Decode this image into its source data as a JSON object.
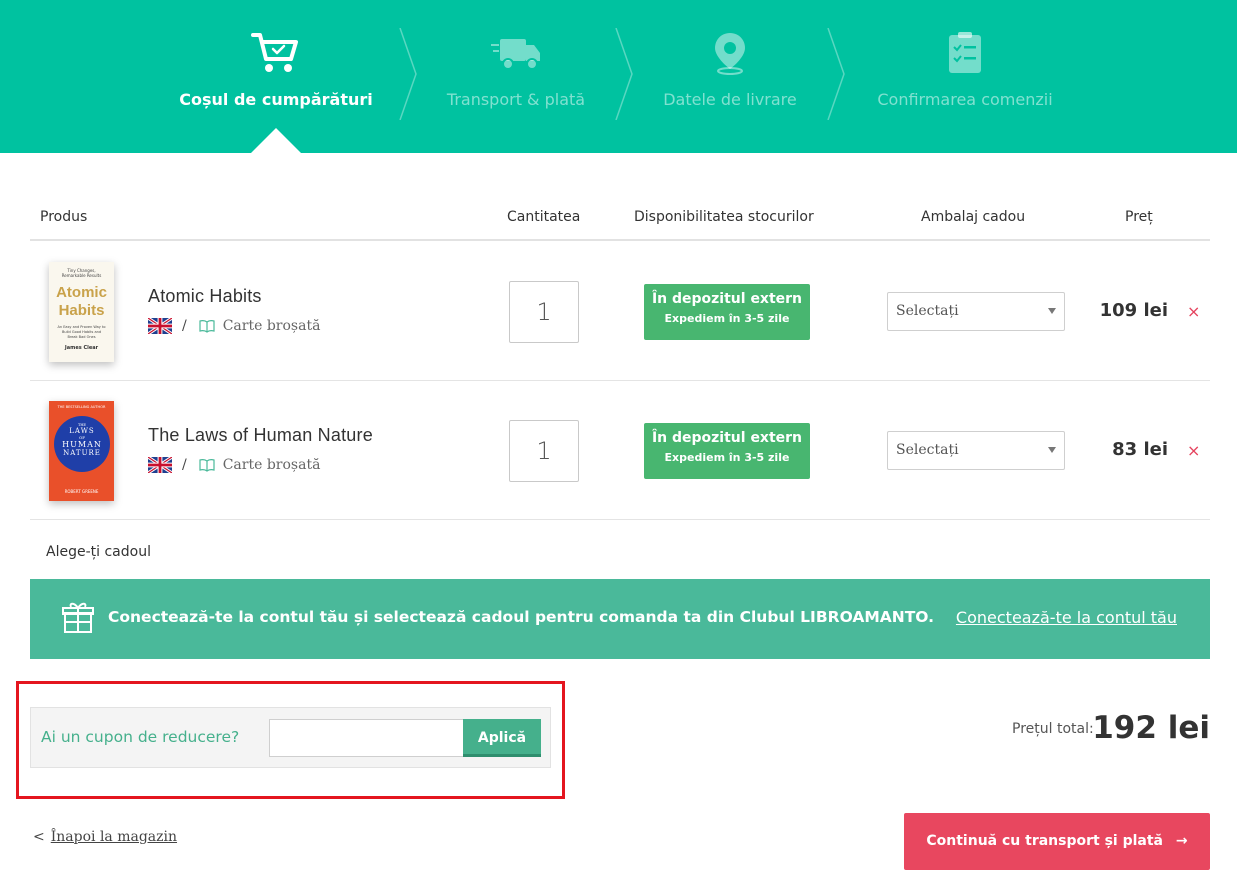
{
  "steps": [
    {
      "label": "Coșul de cumpărături",
      "icon": "cart-icon",
      "active": true
    },
    {
      "label": "Transport & plată",
      "icon": "truck-icon",
      "active": false
    },
    {
      "label": "Datele de livrare",
      "icon": "location-pin-icon",
      "active": false
    },
    {
      "label": "Confirmarea comenzii",
      "icon": "checklist-icon",
      "active": false
    }
  ],
  "table": {
    "headers": {
      "product": "Produs",
      "quantity": "Cantitatea",
      "stock": "Disponibilitatea stocurilor",
      "gift_wrap": "Ambalaj cadou",
      "price": "Preț"
    },
    "rows": [
      {
        "title": "Atomic Habits",
        "format": "Carte broșată",
        "separator": "/",
        "quantity": "1",
        "stock_main": "În depozitul extern",
        "stock_sub": "Expediem în 3-5 zile",
        "gift_select": "Selectați",
        "price": "109 lei",
        "remove": "×",
        "cover": {
          "top": "Tiny Changes, Remarkable Results",
          "title1": "Atomic",
          "title2": "Habits",
          "subtitle": "An Easy and Proven Way to Build Good Habits and Break Bad Ones",
          "author": "James Clear"
        }
      },
      {
        "title": "The Laws of Human Nature",
        "format": "Carte broșată",
        "separator": "/",
        "quantity": "1",
        "stock_main": "În depozitul extern",
        "stock_sub": "Expediem în 3-5 zile",
        "gift_select": "Selectați",
        "price": "83 lei",
        "remove": "×",
        "cover": {
          "top": "THE BESTSELLING AUTHOR",
          "pre": "THE",
          "title1": "LAWS",
          "title2": "OF",
          "title3": "HUMAN",
          "title4": "NATURE",
          "author": "ROBERT GREENE"
        }
      }
    ]
  },
  "gift": {
    "title": "Alege-ți cadoul",
    "banner_text": "Conectează-te la contul tău și selectează cadoul pentru comanda ta din Clubul LIBROAMANTO.",
    "banner_link": "Conectează-te la contul tău"
  },
  "coupon": {
    "label": "Ai un cupon de reducere?",
    "input_value": "",
    "button": "Aplică"
  },
  "total": {
    "label": "Prețul total:",
    "value": "192 lei"
  },
  "footer": {
    "back_chevron": "<",
    "back": "Înapoi la magazin",
    "continue": "Continuă cu transport și plată",
    "continue_arrow": "→"
  },
  "colors": {
    "header_bg": "#00c2a0",
    "stock_green": "#48b670",
    "banner_bg": "#4ab99a",
    "coupon_accent": "#45b08c",
    "continue_bg": "#e8475f",
    "remove_red": "#e5435e",
    "highlight_red": "#e4151f"
  }
}
